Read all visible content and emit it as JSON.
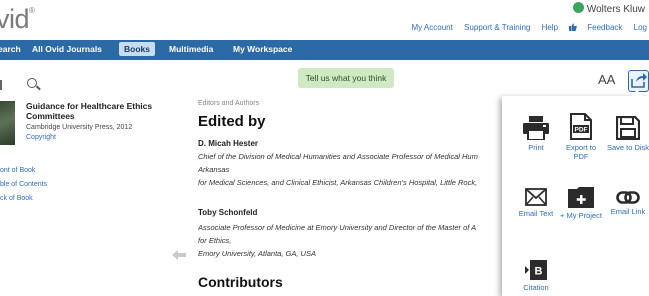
{
  "header": {
    "logo_text": "vid",
    "logo_mark": "®",
    "publisher": "Wolters Kluw",
    "links": [
      "My Account",
      "Support & Training",
      "Help",
      "Feedback",
      "Log"
    ]
  },
  "nav": {
    "items": [
      "earch",
      "All Ovid Journals",
      "Books",
      "Multimedia",
      "My Workspace"
    ],
    "active_index": 2
  },
  "toolbar": {
    "feedback_label": "Tell us what you think",
    "text_size_label": "AA"
  },
  "book": {
    "title": "Guidance for Healthcare Ethics Committees",
    "publisher": "Cambridge University Press, 2012",
    "copyright": "Copyright",
    "links": [
      "ont of Book",
      "ble of Contents",
      "ck of Book"
    ]
  },
  "content": {
    "breadcrumb": "Editors and Authors",
    "heading": "Edited by",
    "authors": [
      {
        "name": "D. Micah Hester",
        "lines": [
          "Chief of the Division of Medical Humanities and Associate Professor of Medical Hum",
          "Arkansas",
          "for Medical Sciences, and Clinical Ethicist, Arkansas Children's Hospital, Little Rock,"
        ]
      },
      {
        "name": "Toby Schonfeld",
        "lines": [
          "Associate Professor of Medicine at Emory University and Director of the Master of A",
          "for Ethics,",
          "Emory University, Atlanta, GA, USA"
        ]
      }
    ],
    "subheading": "Contributors"
  },
  "share_panel": {
    "options": [
      {
        "label": "Print",
        "icon": "printer-icon"
      },
      {
        "label": "Export to PDF",
        "icon": "pdf-icon",
        "badge": "PDF"
      },
      {
        "label": "Save to Disk",
        "icon": "floppy-disk-icon"
      },
      {
        "label": "Email Text",
        "icon": "envelope-icon"
      },
      {
        "label": "+ My Project",
        "icon": "folder-plus-icon"
      },
      {
        "label": "Email Link",
        "icon": "link-icon"
      },
      {
        "label": "Citation",
        "icon": "citation-icon",
        "badge": "B"
      }
    ]
  },
  "colors": {
    "nav_bg": "#2c6aa6",
    "link": "#2f6eb5",
    "feedback_bg": "#cfe9c4",
    "icon": "#2b2b2b"
  }
}
